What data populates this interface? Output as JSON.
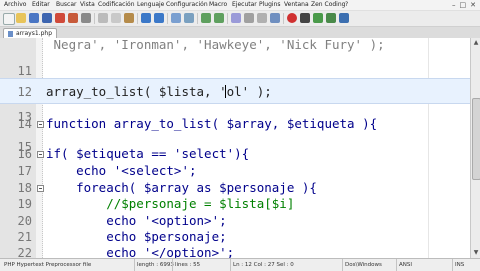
{
  "window": {
    "minimize": "–",
    "maximize": "□",
    "close": "✕"
  },
  "menu": [
    "Archivo",
    "Editar",
    "Buscar",
    "Vista",
    "Codificación",
    "Lenguaje",
    "Configuración",
    "Macro",
    "Ejecutar",
    "Plugins",
    "Ventana",
    "Zen Coding",
    "?"
  ],
  "tab": {
    "label": "arrays1.php"
  },
  "editor": {
    "lines": [
      {
        "num": "",
        "text": " Negra', 'Ironman', 'Hawkeye', 'Nick Fury' );"
      },
      {
        "num": "11",
        "text": ""
      },
      {
        "num": "12",
        "text": "array_to_list( $lista, 'ol' );"
      },
      {
        "num": "13",
        "text": ""
      },
      {
        "num": "14",
        "text": "function array_to_list( $array, $etiqueta ){"
      },
      {
        "num": "15",
        "text": ""
      },
      {
        "num": "16",
        "text": "if( $etiqueta == 'select'){"
      },
      {
        "num": "17",
        "text": "    echo '<select>';"
      },
      {
        "num": "18",
        "text": "    foreach( $array as $personaje ){"
      },
      {
        "num": "19",
        "text": "        //$personaje = $lista[$i]"
      },
      {
        "num": "20",
        "text": "        echo '<option>';"
      },
      {
        "num": "21",
        "text": "        echo $personaje;"
      },
      {
        "num": "22",
        "text": "        echo '</option>';"
      },
      {
        "num": "",
        "text": "    }"
      }
    ]
  },
  "status": {
    "filetype": "PHP Hypertext Preprocessor file",
    "length": "length : 6993",
    "lines": "lines : 55",
    "position": "Ln : 12   Col : 27   Sel : 0",
    "eol": "Dos\\Windows",
    "encoding": "ANSI",
    "mode": "INS"
  },
  "colors": {
    "keyword": "#00008b",
    "string": "#808080",
    "comment": "#008000",
    "current_line": "#e8f2fe"
  }
}
